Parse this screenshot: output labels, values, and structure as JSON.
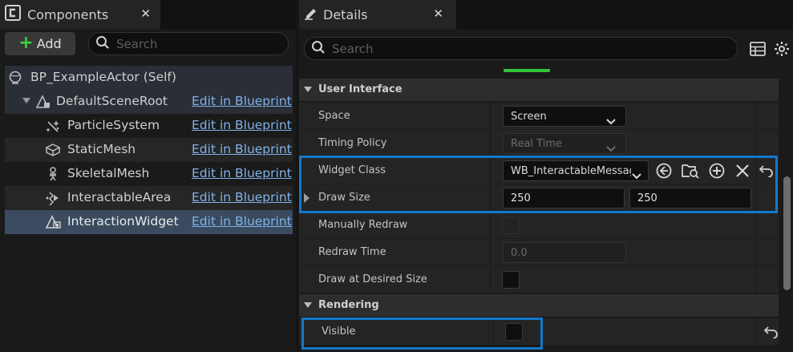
{
  "components_panel": {
    "tab_title": "Components",
    "add_label": "Add",
    "search_placeholder": "Search",
    "root_label": "BP_ExampleActor (Self)",
    "tree": [
      {
        "label": "DefaultSceneRoot",
        "link": "Edit in Blueprint",
        "icon": "scene-root-icon"
      },
      {
        "label": "ParticleSystem",
        "link": "Edit in Blueprint",
        "icon": "particle-system-icon"
      },
      {
        "label": "StaticMesh",
        "link": "Edit in Blueprint",
        "icon": "static-mesh-icon"
      },
      {
        "label": "SkeletalMesh",
        "link": "Edit in Blueprint",
        "icon": "skeletal-mesh-icon"
      },
      {
        "label": "InteractableArea",
        "link": "Edit in Blueprint",
        "icon": "interactable-area-icon"
      },
      {
        "label": "InteractionWidget",
        "link": "Edit in Blueprint",
        "icon": "widget-component-icon"
      }
    ]
  },
  "details_panel": {
    "tab_title": "Details",
    "search_placeholder": "Search",
    "categories": {
      "user_interface": "User Interface",
      "rendering": "Rendering"
    },
    "properties": {
      "space": {
        "label": "Space",
        "value": "Screen"
      },
      "timing_policy": {
        "label": "Timing Policy",
        "value": "Real Time"
      },
      "widget_class": {
        "label": "Widget Class",
        "value": "WB_InteractableMessag"
      },
      "draw_size": {
        "label": "Draw Size",
        "x": "250",
        "y": "250"
      },
      "manually_redraw": {
        "label": "Manually Redraw"
      },
      "redraw_time": {
        "label": "Redraw Time",
        "value": "0.0"
      },
      "draw_at_desired_size": {
        "label": "Draw at Desired Size"
      },
      "visible": {
        "label": "Visible"
      }
    }
  },
  "colors": {
    "highlight": "#1478c8",
    "link": "#7fb2e8",
    "add_plus": "#3ed140"
  }
}
